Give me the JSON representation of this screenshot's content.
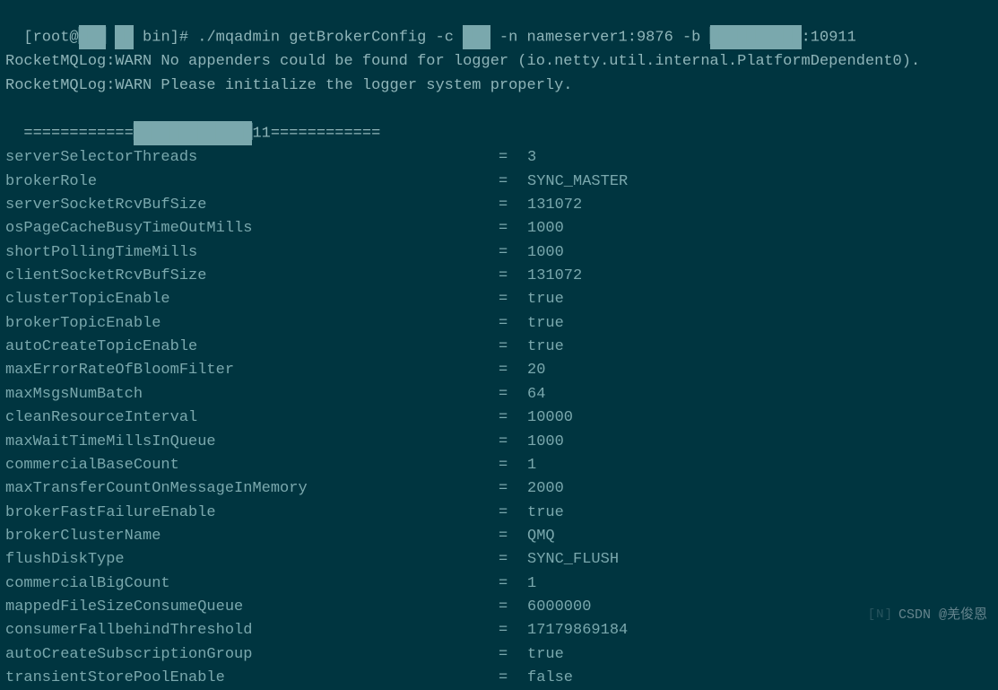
{
  "prompt": {
    "user_host": "[root@",
    "censored1": "███",
    "censored2": "██",
    "path": " bin]# ",
    "command": "./mqadmin getBrokerConfig -c ",
    "censored3": "███",
    "args1": " -n nameserver1:9876 -b ",
    "censored4": "███ ██ ███",
    "args2": ":10911"
  },
  "warn_lines": [
    "RocketMQLog:WARN No appenders could be found for logger (io.netty.util.internal.PlatformDependent0).",
    "RocketMQLog:WARN Please initialize the logger system properly."
  ],
  "separator": {
    "prefix": "============",
    "censored": "█ █ ██ ███ ██",
    "suffix": "11============"
  },
  "config": [
    {
      "key": "serverSelectorThreads",
      "val": "3"
    },
    {
      "key": "brokerRole",
      "val": "SYNC_MASTER"
    },
    {
      "key": "serverSocketRcvBufSize",
      "val": "131072"
    },
    {
      "key": "osPageCacheBusyTimeOutMills",
      "val": "1000"
    },
    {
      "key": "shortPollingTimeMills",
      "val": "1000"
    },
    {
      "key": "clientSocketRcvBufSize",
      "val": "131072"
    },
    {
      "key": "clusterTopicEnable",
      "val": "true"
    },
    {
      "key": "brokerTopicEnable",
      "val": "true"
    },
    {
      "key": "autoCreateTopicEnable",
      "val": "true"
    },
    {
      "key": "maxErrorRateOfBloomFilter",
      "val": "20"
    },
    {
      "key": "maxMsgsNumBatch",
      "val": "64"
    },
    {
      "key": "cleanResourceInterval",
      "val": "10000"
    },
    {
      "key": "maxWaitTimeMillsInQueue",
      "val": "1000"
    },
    {
      "key": "commercialBaseCount",
      "val": "1"
    },
    {
      "key": "maxTransferCountOnMessageInMemory",
      "val": "2000"
    },
    {
      "key": "brokerFastFailureEnable",
      "val": "true"
    },
    {
      "key": "brokerClusterName",
      "val": "QMQ"
    },
    {
      "key": "flushDiskType",
      "val": "SYNC_FLUSH"
    },
    {
      "key": "commercialBigCount",
      "val": "1"
    },
    {
      "key": "mappedFileSizeConsumeQueue",
      "val": "6000000"
    },
    {
      "key": "consumerFallbehindThreshold",
      "val": "17179869184"
    },
    {
      "key": "autoCreateSubscriptionGroup",
      "val": "true"
    },
    {
      "key": "transientStorePoolEnable",
      "val": "false"
    }
  ],
  "watermark": {
    "logo": "[N]",
    "text": "CSDN @羌俊恩"
  }
}
